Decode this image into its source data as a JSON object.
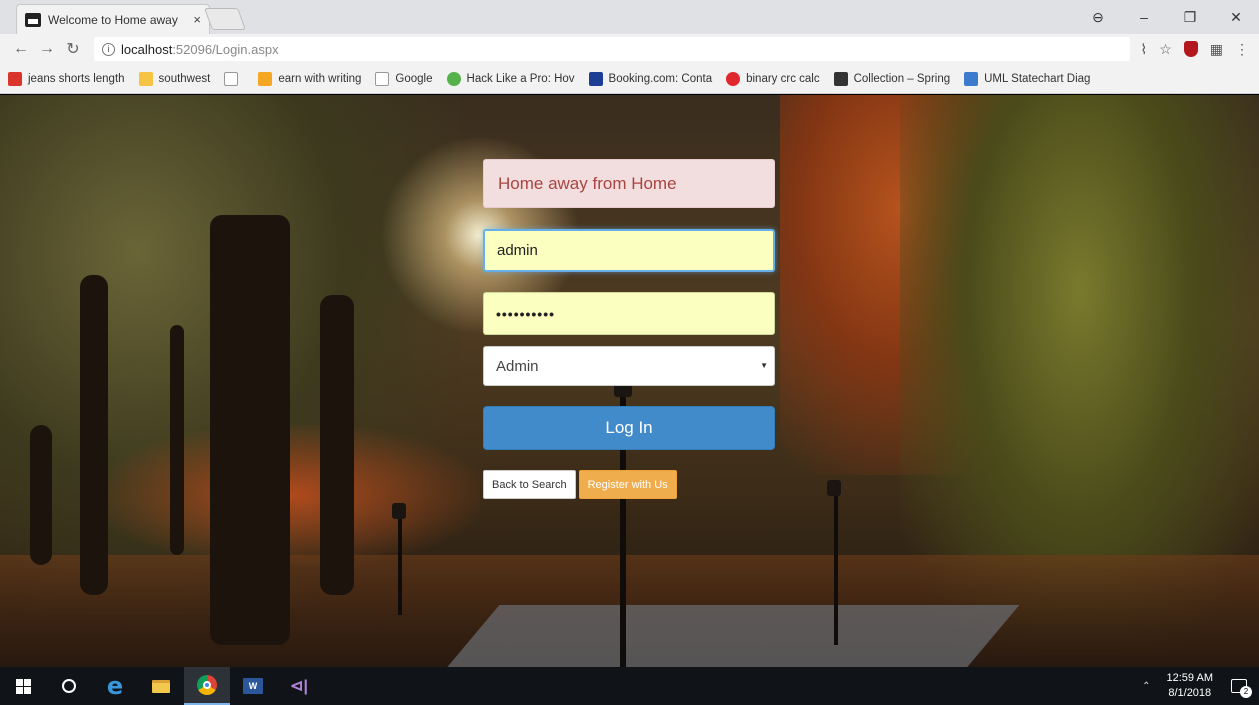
{
  "browser": {
    "tab_title": "Welcome to Home away",
    "tab_close": "×",
    "window_controls": {
      "account": "⊖",
      "minimize": "–",
      "restore": "❐",
      "close": "✕"
    },
    "url_host": "localhost",
    "url_path": ":52096/Login.aspx",
    "nav": {
      "back": "←",
      "forward": "→",
      "reload": "↻"
    },
    "bookmarks": [
      {
        "label": "jeans shorts length",
        "color": "#d9352b"
      },
      {
        "label": "southwest",
        "color": "#f6c342"
      },
      {
        "label": "",
        "color": "#ffffff"
      },
      {
        "label": "earn with writing",
        "color": "#f5a623"
      },
      {
        "label": "Google",
        "color": "#ffffff"
      },
      {
        "label": "Hack Like a Pro: Hov",
        "color": "#55b24a"
      },
      {
        "label": "Booking.com: Conta",
        "color": "#1c3f95"
      },
      {
        "label": "binary crc calc",
        "color": "#e2282f"
      },
      {
        "label": "Collection – Spring",
        "color": "#333333"
      },
      {
        "label": "UML Statechart Diag",
        "color": "#3d7ccc"
      }
    ]
  },
  "login": {
    "banner": "Home away from Home",
    "username": "admin",
    "password_mask": "••••••••••",
    "role_selected": "Admin",
    "login_button": "Log In",
    "back_button": "Back to Search",
    "register_button": "Register with Us"
  },
  "taskbar": {
    "time": "12:59 AM",
    "date": "8/1/2018",
    "notifications": "2",
    "word_label": "W",
    "vs_label": "⊲|"
  },
  "colors": {
    "banner_bg": "#f2dede",
    "banner_text": "#a94442",
    "input_bg": "#fbffc0",
    "login_btn": "#428bca",
    "register_btn": "#f0ad4e"
  }
}
